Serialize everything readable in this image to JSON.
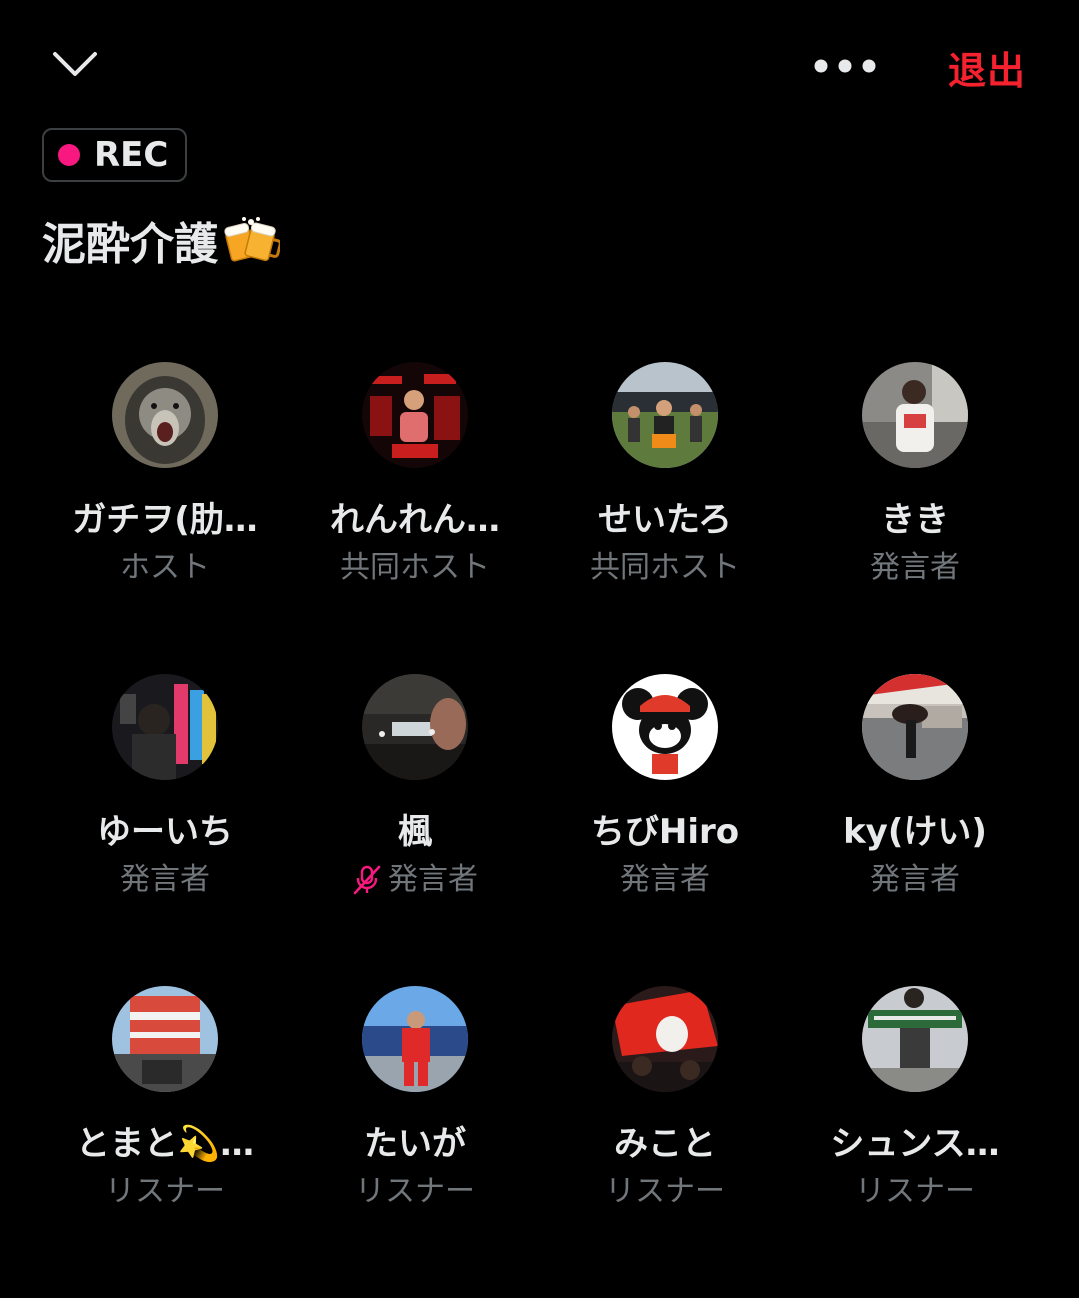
{
  "header": {
    "collapse_icon": "chevron-down-icon",
    "more_icon": "more-horizontal-icon",
    "leave_label": "退出"
  },
  "recording": {
    "label": "REC",
    "dot_color": "#f91880"
  },
  "space": {
    "title": "泥酔介護",
    "title_emoji": "beer-mugs-emoji"
  },
  "colors": {
    "accent_red": "#f4212e",
    "muted_text": "#71767b",
    "mic_muted": "#f91880"
  },
  "participants": [
    {
      "name": "ガチヲ(肋…",
      "role": "ホスト",
      "avatar": "gorilla-photo"
    },
    {
      "name": "れんれん…",
      "role": "共同ホスト",
      "avatar": "red-poster-photo"
    },
    {
      "name": "せいたろ",
      "role": "共同ホスト",
      "avatar": "festival-crowd-photo"
    },
    {
      "name": "きき",
      "role": "発言者",
      "avatar": "person-white-tshirt-photo"
    },
    {
      "name": "ゆーいち",
      "role": "発言者",
      "avatar": "arcade-photo"
    },
    {
      "name": "楓",
      "role": "発言者",
      "avatar": "concert-hall-photo",
      "muted": true,
      "muted_icon": "mic-off-icon"
    },
    {
      "name": "ちびHiro",
      "role": "発言者",
      "avatar": "cartoon-mouse-photo"
    },
    {
      "name": "ky(けい)",
      "role": "発言者",
      "avatar": "umbrella-street-photo"
    },
    {
      "name": "とまと💫…",
      "role": "リスナー",
      "avatar": "stage-truck-photo"
    },
    {
      "name": "たいが",
      "role": "リスナー",
      "avatar": "red-outfit-photo"
    },
    {
      "name": "みこと",
      "role": "リスナー",
      "avatar": "red-flag-photo"
    },
    {
      "name": "シュンス…",
      "role": "リスナー",
      "avatar": "banner-crowd-photo"
    }
  ]
}
